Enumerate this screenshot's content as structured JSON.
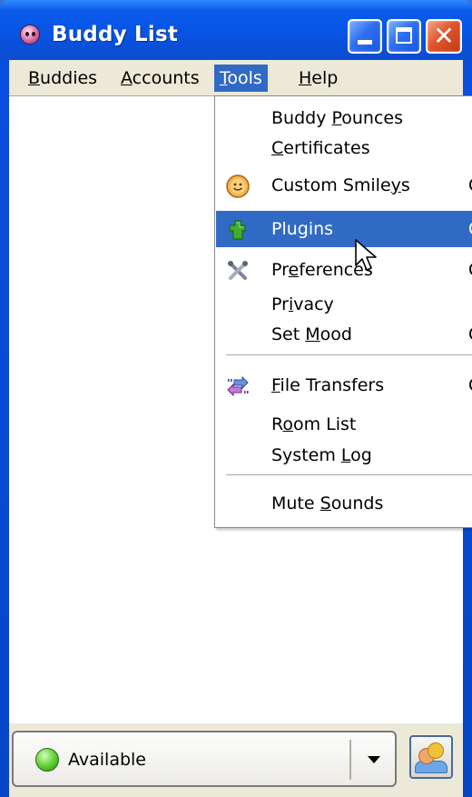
{
  "window": {
    "title": "Buddy List"
  },
  "menubar": {
    "items": [
      {
        "pre": "",
        "u": "B",
        "post": "uddies"
      },
      {
        "pre": "",
        "u": "A",
        "post": "ccounts"
      },
      {
        "pre": "",
        "u": "T",
        "post": "ools"
      },
      {
        "pre": "",
        "u": "H",
        "post": "elp"
      }
    ],
    "open_menu": "Tools"
  },
  "tools_menu": {
    "items": [
      {
        "pre": "Buddy ",
        "u": "P",
        "post": "ounces",
        "icon": null,
        "accel": ""
      },
      {
        "pre": "",
        "u": "C",
        "post": "ertificates",
        "icon": null,
        "accel": ""
      },
      {
        "pre": "Custom Smile",
        "u": "y",
        "post": "s",
        "icon": "smiley-icon",
        "accel": "C"
      },
      {
        "pre": "Plu",
        "u": "g",
        "post": "ins",
        "icon": "plugin-icon",
        "accel": "C",
        "highlighted": true
      },
      {
        "pre": "Pr",
        "u": "e",
        "post": "ferences",
        "icon": "preferences-icon",
        "accel": "C"
      },
      {
        "pre": "Pr",
        "u": "i",
        "post": "vacy",
        "icon": null,
        "accel": ""
      },
      {
        "pre": "Set ",
        "u": "M",
        "post": "ood",
        "icon": null,
        "accel": "C"
      },
      {
        "pre": "",
        "u": "F",
        "post": "ile Transfers",
        "icon": "file-transfer-icon",
        "accel": "C"
      },
      {
        "pre": "R",
        "u": "o",
        "post": "om List",
        "icon": null,
        "accel": ""
      },
      {
        "pre": "System ",
        "u": "L",
        "post": "og",
        "icon": null,
        "accel": ""
      },
      {
        "pre": "Mute ",
        "u": "S",
        "post": "ounds",
        "icon": null,
        "accel": ""
      }
    ]
  },
  "status": {
    "label": "Available",
    "color": "#4cbf2a"
  },
  "colors": {
    "titlebar": "#0755e6",
    "menu_highlight": "#316ac5",
    "close_button": "#e2552c"
  }
}
